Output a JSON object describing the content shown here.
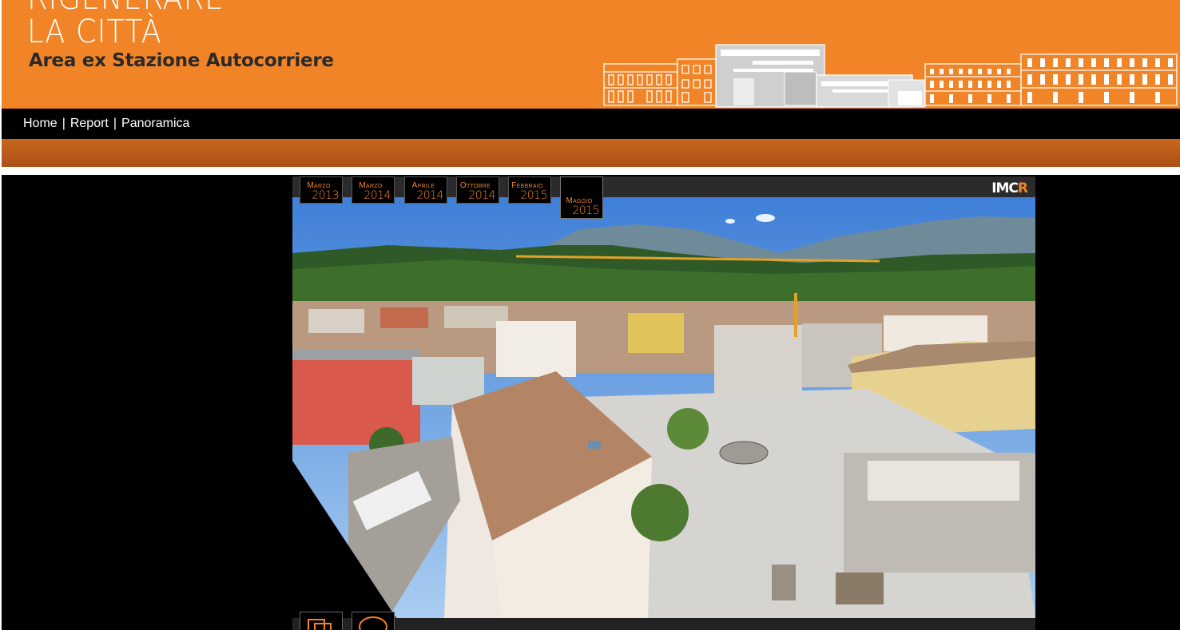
{
  "header": {
    "title_line1": "RIGENERARE",
    "title_line2": "LA CITTÀ",
    "subtitle": "Area ex Stazione Autocorriere"
  },
  "nav": {
    "items": [
      {
        "label": "Home"
      },
      {
        "label": "Report"
      },
      {
        "label": "Panoramica"
      }
    ],
    "separator": "|"
  },
  "viewer": {
    "logo_main": "IMC",
    "logo_accent": "R",
    "tabs": [
      {
        "month": "Marzo",
        "year": "2013",
        "active": false
      },
      {
        "month": "Marzo",
        "year": "2014",
        "active": false
      },
      {
        "month": "Aprile",
        "year": "2014",
        "active": false
      },
      {
        "month": "Ottobre",
        "year": "2014",
        "active": false
      },
      {
        "month": "Febbraio",
        "year": "2015",
        "active": false
      },
      {
        "month": "Maggio",
        "year": "2015",
        "active": true
      }
    ],
    "controls": [
      {
        "icon": "thumbnails-icon"
      },
      {
        "icon": "comment-icon"
      }
    ]
  },
  "colors": {
    "brand_orange": "#f18426",
    "strip_brown": "#b8591a",
    "nav_black": "#000000"
  }
}
